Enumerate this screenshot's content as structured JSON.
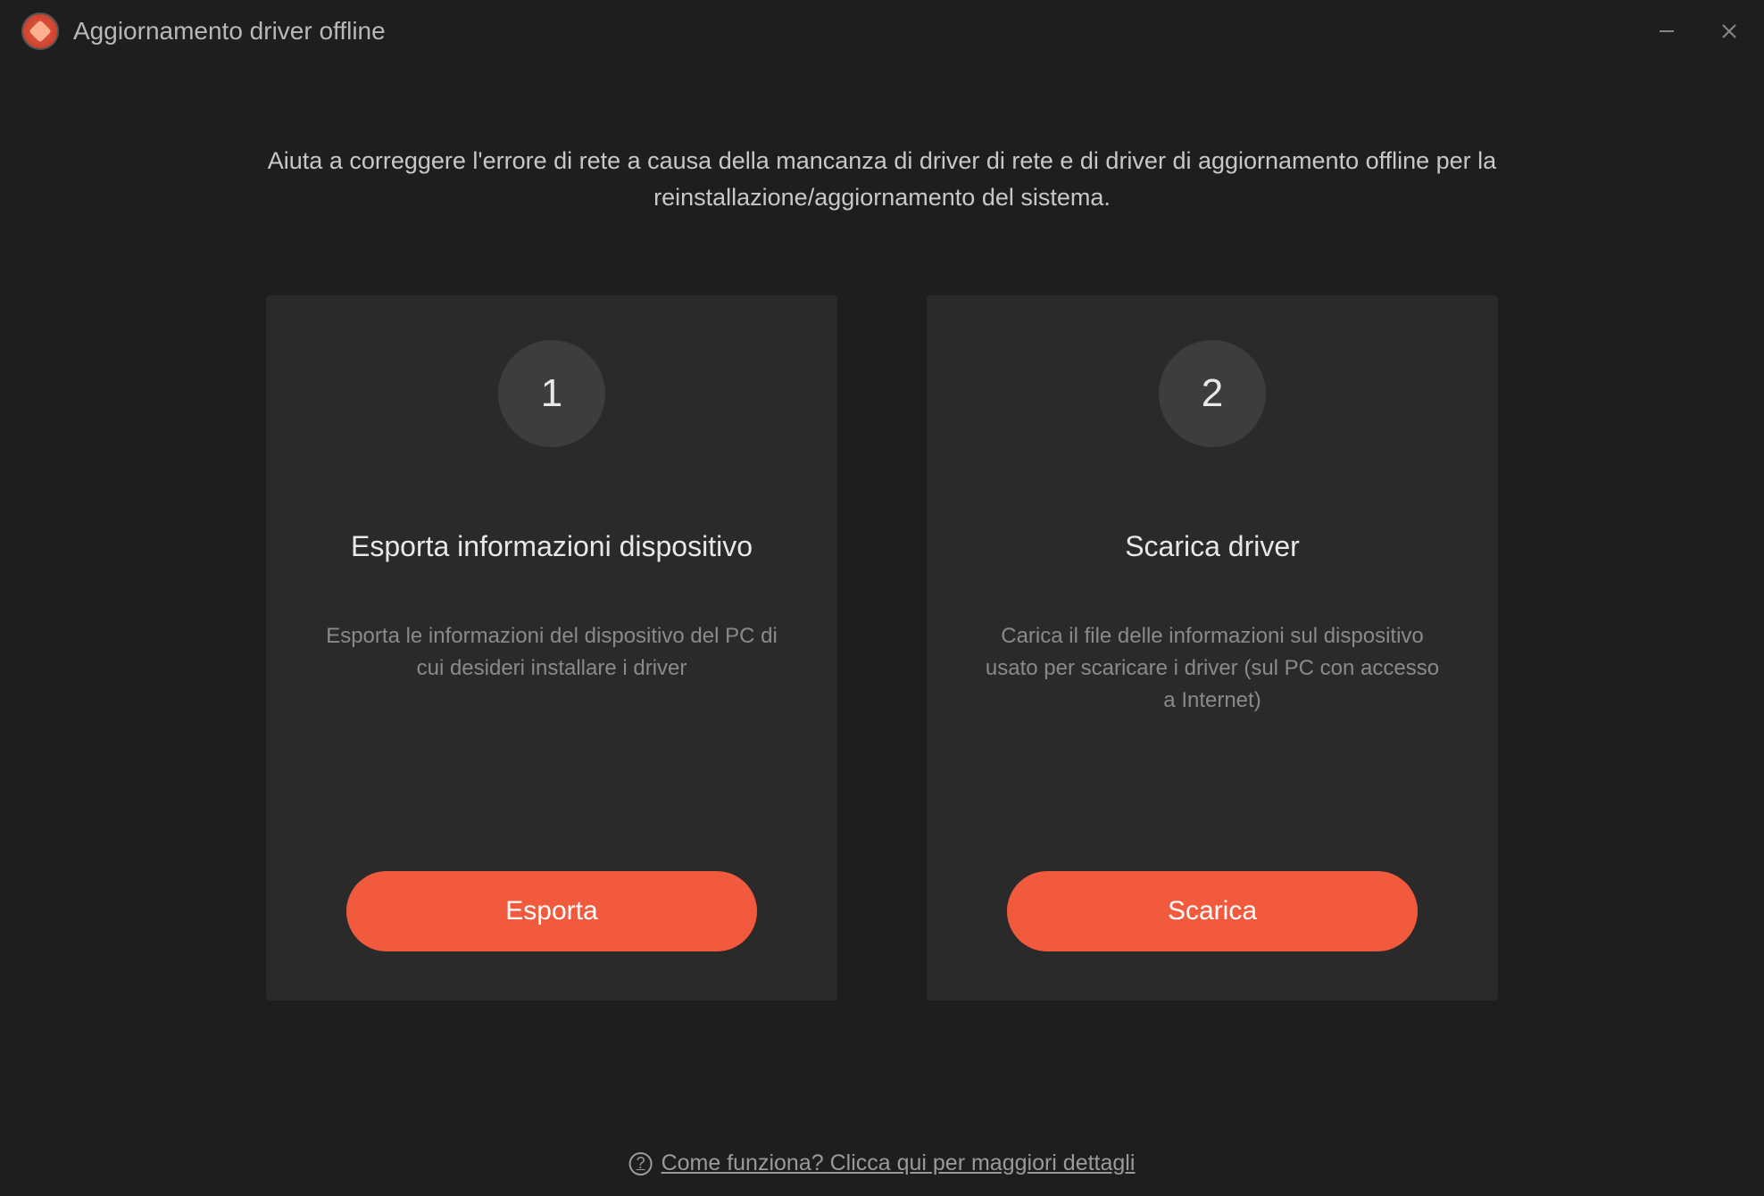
{
  "window": {
    "title": "Aggiornamento driver offline"
  },
  "main": {
    "description": "Aiuta a correggere l'errore di rete a causa della mancanza di driver di rete e di driver di aggiornamento offline per la reinstallazione/aggiornamento del sistema."
  },
  "cards": [
    {
      "step": "1",
      "title": "Esporta informazioni dispositivo",
      "description": "Esporta le informazioni del dispositivo del PC di cui desideri installare i driver",
      "button": "Esporta"
    },
    {
      "step": "2",
      "title": "Scarica driver",
      "description": "Carica il file delle informazioni sul dispositivo usato per scaricare i driver (sul PC con accesso a Internet)",
      "button": "Scarica"
    }
  ],
  "footer": {
    "help_text": "Come funziona? Clicca qui per maggiori dettagli"
  }
}
